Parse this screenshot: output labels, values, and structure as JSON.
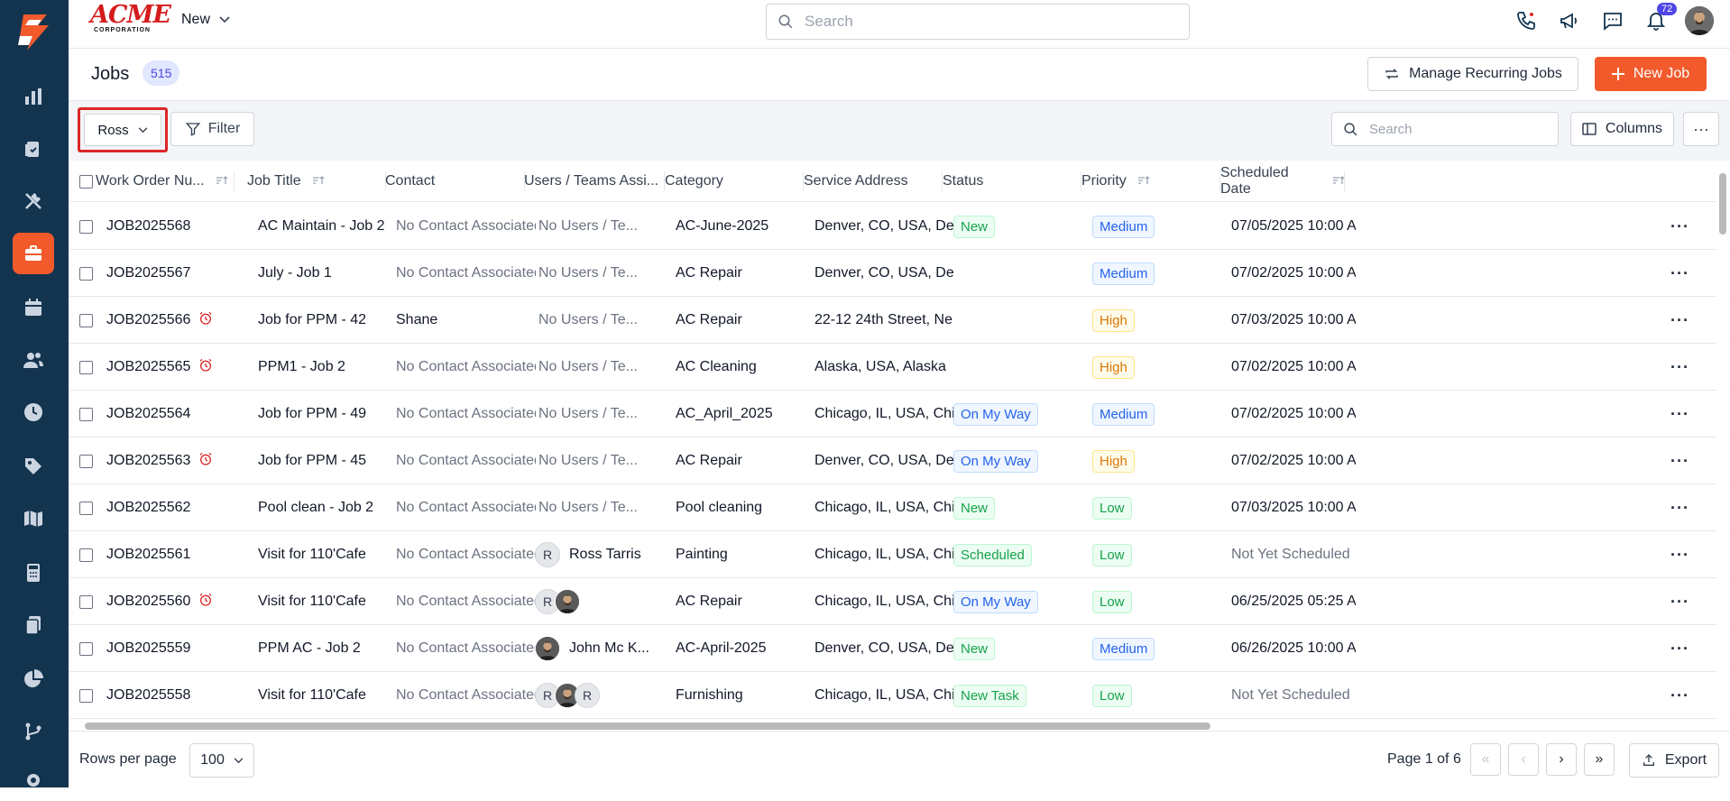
{
  "topbar": {
    "brand_text": "ACME",
    "brand_sub": "CORPORATION",
    "new_label": "New",
    "search_placeholder": "Search",
    "notification_count": "72"
  },
  "header": {
    "title": "Jobs",
    "count": "515",
    "recurring_label": "Manage Recurring Jobs",
    "new_job_label": "New Job"
  },
  "toolbar": {
    "view_label": "Ross",
    "filter_label": "Filter",
    "search_placeholder": "Search",
    "columns_label": "Columns"
  },
  "table": {
    "headers": [
      "Work Order Nu...",
      "Job Title",
      "Contact",
      "Users / Teams Assi...",
      "Category",
      "Service Address",
      "Status",
      "Priority",
      "Scheduled Date"
    ],
    "rows": [
      {
        "wo": "JOB2025568",
        "alarm": false,
        "title": "AC Maintain - Job 2",
        "contact": "No Contact Associated",
        "contact_muted": true,
        "users": "No Users / Te...",
        "users_type": "none",
        "category": "AC-June-2025",
        "address": "Denver, CO, USA, De...",
        "status": "New",
        "priority": "Medium",
        "date": "07/05/2025 10:00 A...",
        "date_muted": false
      },
      {
        "wo": "JOB2025567",
        "alarm": false,
        "title": "July - Job 1",
        "contact": "No Contact Associated",
        "contact_muted": true,
        "users": "No Users / Te...",
        "users_type": "none",
        "category": "AC Repair",
        "address": "Denver, CO, USA, De...",
        "status": "",
        "priority": "Medium",
        "date": "07/02/2025 10:00 A...",
        "date_muted": false
      },
      {
        "wo": "JOB2025566",
        "alarm": true,
        "title": "Job for PPM - 42",
        "contact": "Shane",
        "contact_muted": false,
        "users": "No Users / Te...",
        "users_type": "none",
        "category": "AC Repair",
        "address": "22-12 24th Street, Ne...",
        "status": "",
        "priority": "High",
        "date": "07/03/2025 10:00 A...",
        "date_muted": false
      },
      {
        "wo": "JOB2025565",
        "alarm": true,
        "title": "PPM1 - Job 2",
        "contact": "No Contact Associated",
        "contact_muted": true,
        "users": "No Users / Te...",
        "users_type": "none",
        "category": "AC Cleaning",
        "address": "Alaska, USA, Alaska",
        "status": "",
        "priority": "High",
        "date": "07/02/2025 10:00 A...",
        "date_muted": false
      },
      {
        "wo": "JOB2025564",
        "alarm": false,
        "title": "Job for PPM - 49",
        "contact": "No Contact Associated",
        "contact_muted": true,
        "users": "No Users / Te...",
        "users_type": "none",
        "category": "AC_April_2025",
        "address": "Chicago, IL, USA, Chi...",
        "status": "On My Way",
        "priority": "Medium",
        "date": "07/02/2025 10:00 A...",
        "date_muted": false
      },
      {
        "wo": "JOB2025563",
        "alarm": true,
        "title": "Job for PPM - 45",
        "contact": "No Contact Associated",
        "contact_muted": true,
        "users": "No Users / Te...",
        "users_type": "none",
        "category": "AC Repair",
        "address": "Denver, CO, USA, De...",
        "status": "On My Way",
        "priority": "High",
        "date": "07/02/2025 10:00 A...",
        "date_muted": false
      },
      {
        "wo": "JOB2025562",
        "alarm": false,
        "title": "Pool clean - Job 2",
        "contact": "No Contact Associated",
        "contact_muted": true,
        "users": "No Users / Te...",
        "users_type": "none",
        "category": "Pool cleaning",
        "address": "Chicago, IL, USA, Chi...",
        "status": "New",
        "priority": "Low",
        "date": "07/03/2025 10:00 A...",
        "date_muted": false
      },
      {
        "wo": "JOB2025561",
        "alarm": false,
        "title": "Visit for 110'Cafe",
        "contact": "No Contact Associated",
        "contact_muted": true,
        "users": "Ross Tarris",
        "users_type": "r-name",
        "category": "Painting",
        "address": "Chicago, IL, USA, Chi...",
        "status": "Scheduled",
        "priority": "Low",
        "date": "Not Yet Scheduled",
        "date_muted": true
      },
      {
        "wo": "JOB2025560",
        "alarm": true,
        "title": "Visit for 110'Cafe",
        "contact": "No Contact Associated",
        "contact_muted": true,
        "users": "",
        "users_type": "r-photo",
        "category": "AC Repair",
        "address": "Chicago, IL, USA, Chi...",
        "status": "On My Way",
        "priority": "Low",
        "date": "06/25/2025 05:25 A...",
        "date_muted": false
      },
      {
        "wo": "JOB2025559",
        "alarm": false,
        "title": "PPM AC - Job 2",
        "contact": "No Contact Associated",
        "contact_muted": true,
        "users": "John Mc K...",
        "users_type": "photo-name",
        "category": "AC-April-2025",
        "address": "Denver, CO, USA, De...",
        "status": "New",
        "priority": "Medium",
        "date": "06/26/2025 10:00 A...",
        "date_muted": false
      },
      {
        "wo": "JOB2025558",
        "alarm": false,
        "title": "Visit for 110'Cafe",
        "contact": "No Contact Associated",
        "contact_muted": true,
        "users": "",
        "users_type": "r-photo-r",
        "category": "Furnishing",
        "address": "Chicago, IL, USA, Chi...",
        "status": "New Task",
        "priority": "Low",
        "date": "Not Yet Scheduled",
        "date_muted": true
      }
    ]
  },
  "tag_colors": {
    "New": {
      "fg": "#16a34a",
      "bg": "#ecfdf3",
      "bd": "#bbf7d0"
    },
    "New Task": {
      "fg": "#16a34a",
      "bg": "#ecfdf3",
      "bd": "#bbf7d0"
    },
    "On My Way": {
      "fg": "#2563eb",
      "bg": "#eff6ff",
      "bd": "#bfdbfe"
    },
    "Scheduled": {
      "fg": "#16a34a",
      "bg": "#ecfdf3",
      "bd": "#bbf7d0"
    },
    "Medium": {
      "fg": "#2563eb",
      "bg": "#eff6ff",
      "bd": "#bfdbfe"
    },
    "High": {
      "fg": "#d97706",
      "bg": "#fffbeb",
      "bd": "#fde68a"
    },
    "Low": {
      "fg": "#16a34a",
      "bg": "#ecfdf3",
      "bd": "#bbf7d0"
    }
  },
  "footer": {
    "rows_per_page_label": "Rows per page",
    "rows_per_page_value": "100",
    "page_info": "Page 1 of 6",
    "export_label": "Export"
  },
  "colors": {
    "sidebar": "#13344f",
    "accent": "#f25a2c",
    "highlight_border": "#dc2626"
  }
}
